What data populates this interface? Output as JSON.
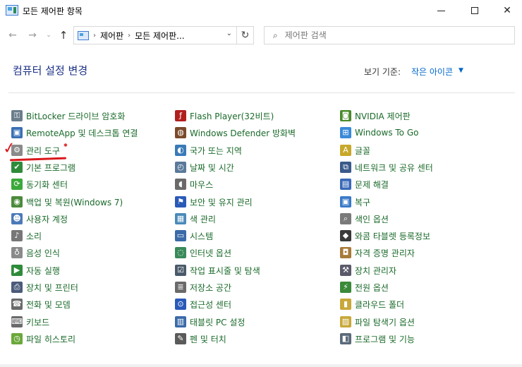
{
  "window": {
    "title": "모든 제어판 항목",
    "minimize": "",
    "maximize": "",
    "close": "✕"
  },
  "nav": {
    "back": "←",
    "forward": "→",
    "recent": "⌄",
    "up": "↑",
    "breadcrumb": [
      "제어판",
      "모든 제어판..."
    ],
    "separator": "›",
    "dropdown": "⌄",
    "refresh": "↻"
  },
  "search": {
    "icon": "⌕",
    "placeholder": "제어판 검색"
  },
  "header": {
    "title": "컴퓨터 설정 변경",
    "view_by_label": "보기 기준:",
    "view_by_value": "작은 아이콘",
    "view_by_arrow": "▼"
  },
  "annotation": {
    "check": "✓",
    "star": "✱",
    "color": "#d9191c"
  },
  "items": {
    "col1": [
      {
        "label": "BitLocker 드라이브 암호화",
        "icon": "bitlocker-icon",
        "glyph": "⚿",
        "color": "#6a7e8c"
      },
      {
        "label": "RemoteApp 및 데스크톱 연결",
        "icon": "remoteapp-icon",
        "glyph": "▣",
        "color": "#3a6fb5"
      },
      {
        "label": "관리 도구",
        "icon": "admin-tools-icon",
        "glyph": "⚙",
        "color": "#8a8a8a"
      },
      {
        "label": "기본 프로그램",
        "icon": "default-programs-icon",
        "glyph": "✔",
        "color": "#2e8b3a"
      },
      {
        "label": "동기화 센터",
        "icon": "sync-center-icon",
        "glyph": "⟳",
        "color": "#3aa83a"
      },
      {
        "label": "백업 및 복원(Windows 7)",
        "icon": "backup-icon",
        "glyph": "◉",
        "color": "#4a8a3a"
      },
      {
        "label": "사용자 계정",
        "icon": "user-accounts-icon",
        "glyph": "☻",
        "color": "#4a7ab8"
      },
      {
        "label": "소리",
        "icon": "sound-icon",
        "glyph": "♪",
        "color": "#777777"
      },
      {
        "label": "음성 인식",
        "icon": "speech-icon",
        "glyph": "♁",
        "color": "#8a8a8a"
      },
      {
        "label": "자동 실행",
        "icon": "autoplay-icon",
        "glyph": "▶",
        "color": "#2e8b3a"
      },
      {
        "label": "장치 및 프린터",
        "icon": "devices-printers-icon",
        "glyph": "⎙",
        "color": "#4a5a7a"
      },
      {
        "label": "전화 및 모뎀",
        "icon": "phone-modem-icon",
        "glyph": "☎",
        "color": "#6a6a6a"
      },
      {
        "label": "키보드",
        "icon": "keyboard-icon",
        "glyph": "⌨",
        "color": "#6a6a6a"
      },
      {
        "label": "파일 히스토리",
        "icon": "file-history-icon",
        "glyph": "◷",
        "color": "#6aa83a"
      }
    ],
    "col2": [
      {
        "label": "Flash Player(32비트)",
        "icon": "flash-player-icon",
        "glyph": "ƒ",
        "color": "#b0201e"
      },
      {
        "label": "Windows Defender 방화벽",
        "icon": "firewall-icon",
        "glyph": "◍",
        "color": "#7a4a2a"
      },
      {
        "label": "국가 또는 지역",
        "icon": "region-icon",
        "glyph": "◐",
        "color": "#3a7ab8"
      },
      {
        "label": "날짜 및 시간",
        "icon": "date-time-icon",
        "glyph": "◴",
        "color": "#5a7a9a"
      },
      {
        "label": "마우스",
        "icon": "mouse-icon",
        "glyph": "◖",
        "color": "#6a6a6a"
      },
      {
        "label": "보안 및 유지 관리",
        "icon": "security-maintenance-icon",
        "glyph": "⚑",
        "color": "#2a5ab8"
      },
      {
        "label": "색 관리",
        "icon": "color-management-icon",
        "glyph": "▦",
        "color": "#4a8ab8"
      },
      {
        "label": "시스템",
        "icon": "system-icon",
        "glyph": "▭",
        "color": "#3a6aa8"
      },
      {
        "label": "인터넷 옵션",
        "icon": "internet-options-icon",
        "glyph": "◌",
        "color": "#3a8a5a"
      },
      {
        "label": "작업 표시줄 및 탐색",
        "icon": "taskbar-icon",
        "glyph": "☑",
        "color": "#4a5a6a"
      },
      {
        "label": "저장소 공간",
        "icon": "storage-spaces-icon",
        "glyph": "≣",
        "color": "#6a6a6a"
      },
      {
        "label": "접근성 센터",
        "icon": "ease-of-access-icon",
        "glyph": "⊙",
        "color": "#2a5ab8"
      },
      {
        "label": "태블릿 PC 설정",
        "icon": "tablet-settings-icon",
        "glyph": "▥",
        "color": "#3a6aa8"
      },
      {
        "label": "펜 및 터치",
        "icon": "pen-touch-icon",
        "glyph": "✎",
        "color": "#5a5a5a"
      }
    ],
    "col3": [
      {
        "label": "NVIDIA 제어판",
        "icon": "nvidia-icon",
        "glyph": "◙",
        "color": "#4a8a2a"
      },
      {
        "label": "Windows To Go",
        "icon": "windows-to-go-icon",
        "glyph": "⊞",
        "color": "#3a8ad8"
      },
      {
        "label": "글꼴",
        "icon": "fonts-icon",
        "glyph": "A",
        "color": "#c8a82a"
      },
      {
        "label": "네트워크 및 공유 센터",
        "icon": "network-sharing-icon",
        "glyph": "⧉",
        "color": "#3a5a8a"
      },
      {
        "label": "문제 해결",
        "icon": "troubleshooting-icon",
        "glyph": "▤",
        "color": "#3a6ab8"
      },
      {
        "label": "복구",
        "icon": "recovery-icon",
        "glyph": "▣",
        "color": "#3a7ac8"
      },
      {
        "label": "색인 옵션",
        "icon": "indexing-options-icon",
        "glyph": "⌕",
        "color": "#7a7a7a"
      },
      {
        "label": "와콤 타블렛 등록정보",
        "icon": "wacom-tablet-icon",
        "glyph": "◆",
        "color": "#3a3a3a"
      },
      {
        "label": "자격 증명 관리자",
        "icon": "credential-manager-icon",
        "glyph": "◘",
        "color": "#a87a3a"
      },
      {
        "label": "장치 관리자",
        "icon": "device-manager-icon",
        "glyph": "⚒",
        "color": "#5a5a6a"
      },
      {
        "label": "전원 옵션",
        "icon": "power-options-icon",
        "glyph": "⚡",
        "color": "#3a8a3a"
      },
      {
        "label": "클라우드 폴더",
        "icon": "cloud-folder-icon",
        "glyph": "▮",
        "color": "#c8a83a"
      },
      {
        "label": "파일 탐색기 옵션",
        "icon": "file-explorer-options-icon",
        "glyph": "▨",
        "color": "#c8a83a"
      },
      {
        "label": "프로그램 및 기능",
        "icon": "programs-features-icon",
        "glyph": "◧",
        "color": "#5a6a7a"
      }
    ]
  }
}
